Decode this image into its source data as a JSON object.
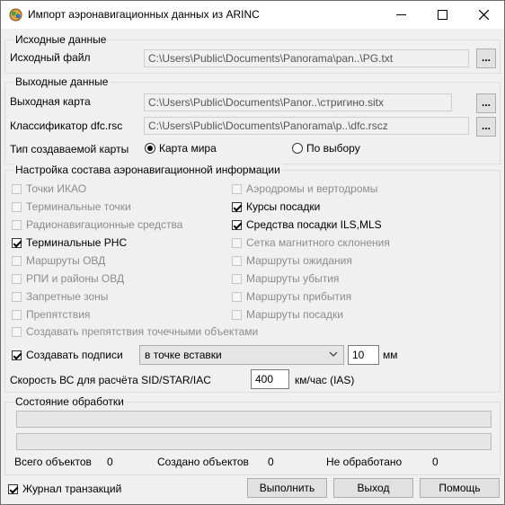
{
  "window": {
    "title": "Импорт аэронавигационных данных из ARINC"
  },
  "source": {
    "group_label": "Исходные данные",
    "file_label": "Исходный файл",
    "file_value": "C:\\Users\\Public\\Documents\\Panorama\\pan..\\PG.txt",
    "browse_label": "..."
  },
  "output": {
    "group_label": "Выходные данные",
    "map_label": "Выходная карта",
    "map_value": "C:\\Users\\Public\\Documents\\Panor..\\стригино.sitx",
    "classifier_label": "Классификатор dfc.rsc",
    "classifier_value": "C:\\Users\\Public\\Documents\\Panorama\\p..\\dfc.rscz",
    "browse_label": "...",
    "map_type_label": "Тип создаваемой карты",
    "radio_world": "Карта мира",
    "radio_custom": "По выбору",
    "selected": "world"
  },
  "content": {
    "group_label": "Настройка состава аэронавигационной информации",
    "left": [
      {
        "label": "Точки ИКАО",
        "checked": false,
        "enabled": false
      },
      {
        "label": "Терминальные точки",
        "checked": false,
        "enabled": false
      },
      {
        "label": "Радионавигационные средства",
        "checked": false,
        "enabled": false
      },
      {
        "label": "Терминальные РНС",
        "checked": true,
        "enabled": true
      },
      {
        "label": "Маршруты ОВД",
        "checked": false,
        "enabled": false
      },
      {
        "label": "РПИ и районы ОВД",
        "checked": false,
        "enabled": false
      },
      {
        "label": "Запретные зоны",
        "checked": false,
        "enabled": false
      },
      {
        "label": "Препятствия",
        "checked": false,
        "enabled": false
      }
    ],
    "right": [
      {
        "label": "Аэродромы и вертодромы",
        "checked": false,
        "enabled": false
      },
      {
        "label": "Курсы посадки",
        "checked": true,
        "enabled": true
      },
      {
        "label": "Средства посадки ILS,MLS",
        "checked": true,
        "enabled": true
      },
      {
        "label": "Сетка магнитного склонения",
        "checked": false,
        "enabled": false
      },
      {
        "label": "Маршруты ожидания",
        "checked": false,
        "enabled": false
      },
      {
        "label": "Маршруты убытия",
        "checked": false,
        "enabled": false
      },
      {
        "label": "Маршруты прибытия",
        "checked": false,
        "enabled": false
      },
      {
        "label": "Маршруты посадки",
        "checked": false,
        "enabled": false
      }
    ],
    "obstacles_points": {
      "label": "Создавать препятствия точечными объектами",
      "checked": false,
      "enabled": false
    },
    "captions": {
      "label": "Создавать подписи",
      "checked": true,
      "enabled": true
    },
    "caption_position": "в точке вставки",
    "caption_size": "10",
    "caption_unit": "мм",
    "speed_label": "Скорость ВС для расчёта SID/STAR/IAC",
    "speed_value": "400",
    "speed_unit": "км/час (IAS)"
  },
  "status": {
    "group_label": "Состояние обработки",
    "progress1": 0,
    "progress2": 0,
    "total_label": "Всего объектов",
    "total_value": "0",
    "created_label": "Создано объектов",
    "created_value": "0",
    "unprocessed_label": "Не обработано",
    "unprocessed_value": "0"
  },
  "footer": {
    "journal": {
      "label": "Журнал транзакций",
      "checked": true
    },
    "run_label": "Выполнить",
    "exit_label": "Выход",
    "help_label": "Помощь"
  }
}
